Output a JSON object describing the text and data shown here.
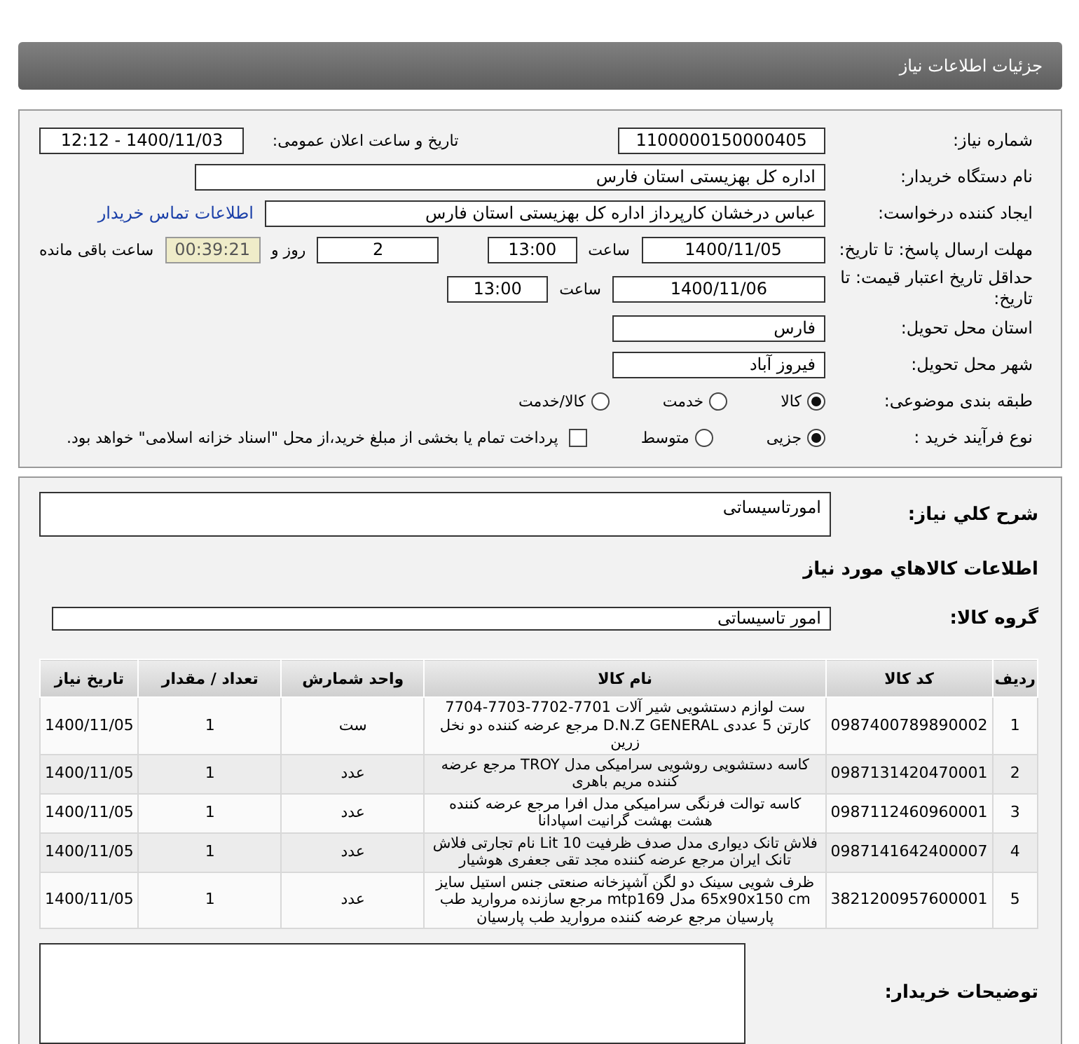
{
  "header": {
    "title": "جزئیات اطلاعات نیاز"
  },
  "need_number": {
    "label": "شماره نیاز:",
    "value": "1100000150000405"
  },
  "announce": {
    "label": "تاریخ و ساعت اعلان عمومی:",
    "value": "1400/11/03 - 12:12"
  },
  "buyer_org": {
    "label": "نام دستگاه خریدار:",
    "value": "اداره کل بهزیستی استان فارس"
  },
  "requester": {
    "label": "ایجاد کننده درخواست:",
    "value": "عباس درخشان کارپرداز اداره کل بهزیستی استان فارس",
    "link": "اطلاعات تماس خریدار"
  },
  "response_deadline": {
    "label": "مهلت ارسال پاسخ: تا تاریخ:",
    "date": "1400/11/05",
    "time_label": "ساعت",
    "time": "13:00",
    "days": "2",
    "days_label": "روز و",
    "remaining": "00:39:21",
    "remaining_label": "ساعت باقی مانده"
  },
  "price_validity": {
    "label": "حداقل تاریخ اعتبار قیمت: تا تاریخ:",
    "date": "1400/11/06",
    "time_label": "ساعت",
    "time": "13:00"
  },
  "province": {
    "label": "استان محل تحویل:",
    "value": "فارس"
  },
  "city": {
    "label": "شهر محل تحویل:",
    "value": "فیروز آباد"
  },
  "category": {
    "label": "طبقه بندی موضوعی:",
    "options": [
      {
        "label": "کالا",
        "selected": true
      },
      {
        "label": "خدمت",
        "selected": false
      },
      {
        "label": "کالا/خدمت",
        "selected": false
      }
    ]
  },
  "purchase_type": {
    "label": "نوع فرآیند خرید :",
    "options": [
      {
        "label": "جزیی",
        "selected": true
      },
      {
        "label": "متوسط",
        "selected": false
      }
    ],
    "payment": {
      "label": "پرداخت تمام یا بخشی از مبلغ خرید،از محل \"اسناد خزانه اسلامی\" خواهد بود.",
      "checked": false
    }
  },
  "description": {
    "label": "شرح كلي نياز:",
    "value": "امورتاسیساتی"
  },
  "goods_heading": "اطلاعات كالاهاي مورد نياز",
  "goods_group": {
    "label": "گروه كالا:",
    "value": "امور تاسیساتی"
  },
  "table": {
    "columns": [
      "ردیف",
      "کد کالا",
      "نام کالا",
      "واحد شمارش",
      "تعداد / مقدار",
      "تاریخ نیاز"
    ],
    "rows": [
      {
        "cells": [
          "1",
          "0987400789890002",
          "ست لوازم دستشویی شیر آلات 7701-7702-7703-7704 کارتن 5 عددی D.N.Z GENERAL مرجع عرضه کننده دو نخل زرین",
          "ست",
          "1",
          "1400/11/05"
        ]
      },
      {
        "cells": [
          "2",
          "0987131420470001",
          "کاسه دستشویی روشویی سرامیکی مدل TROY مرجع عرضه کننده مریم باهری",
          "عدد",
          "1",
          "1400/11/05"
        ]
      },
      {
        "cells": [
          "3",
          "0987112460960001",
          "کاسه توالت فرنگی سرامیکی مدل افرا مرجع عرضه کننده هشت بهشت گرانیت اسپادانا",
          "عدد",
          "1",
          "1400/11/05"
        ]
      },
      {
        "cells": [
          "4",
          "0987141642400007",
          "فلاش تانک دیواری مدل صدف ظرفیت Lit 10 نام تجارتی فلاش تانک ایران مرجع عرضه کننده مجد تقی جعفری هوشیار",
          "عدد",
          "1",
          "1400/11/05"
        ]
      },
      {
        "cells": [
          "5",
          "3821200957600001",
          "ظرف شویی سینک دو لگن آشپزخانه صنعتی جنس استیل سایز 65x90x150 cm مدل mtp169 مرجع سازنده مروارید طب پارسیان مرجع عرضه کننده مروارید طب پارسیان",
          "عدد",
          "1",
          "1400/11/05"
        ]
      }
    ]
  },
  "buyer_notes": {
    "label": "توضیحات خریدار:"
  }
}
